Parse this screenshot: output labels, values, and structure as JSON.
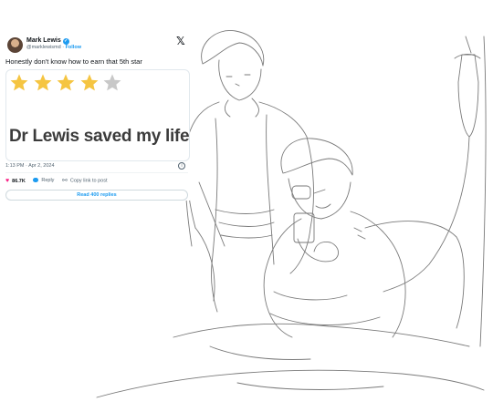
{
  "post": {
    "author_name": "Mark Lewis",
    "handle": "@marklewismd",
    "separator": " · ",
    "follow_label": "Follow",
    "text": "Honestly don't know how to earn that 5th star",
    "media": {
      "rating_stars_filled": 4,
      "rating_stars_total": 5,
      "star_color": "#f5c542",
      "empty_star_color": "#c8c8c8",
      "review_text": "Dr Lewis saved my life!"
    },
    "timestamp": "1:13 PM · Apr 2, 2024",
    "info_icon_glyph": "i",
    "actions": {
      "like_count": "86.7K",
      "reply_label": "Reply",
      "copy_link_label": "Copy link to post"
    },
    "read_replies_label": "Read 400 replies",
    "accent_color": "#1d9bf0",
    "heart_color": "#f91880"
  },
  "icons": {
    "platform_logo": "x-logo",
    "verified": "verified-badge-icon",
    "like": "heart-icon",
    "reply": "reply-bubble-icon",
    "copy_link": "link-icon",
    "info": "info-icon"
  }
}
